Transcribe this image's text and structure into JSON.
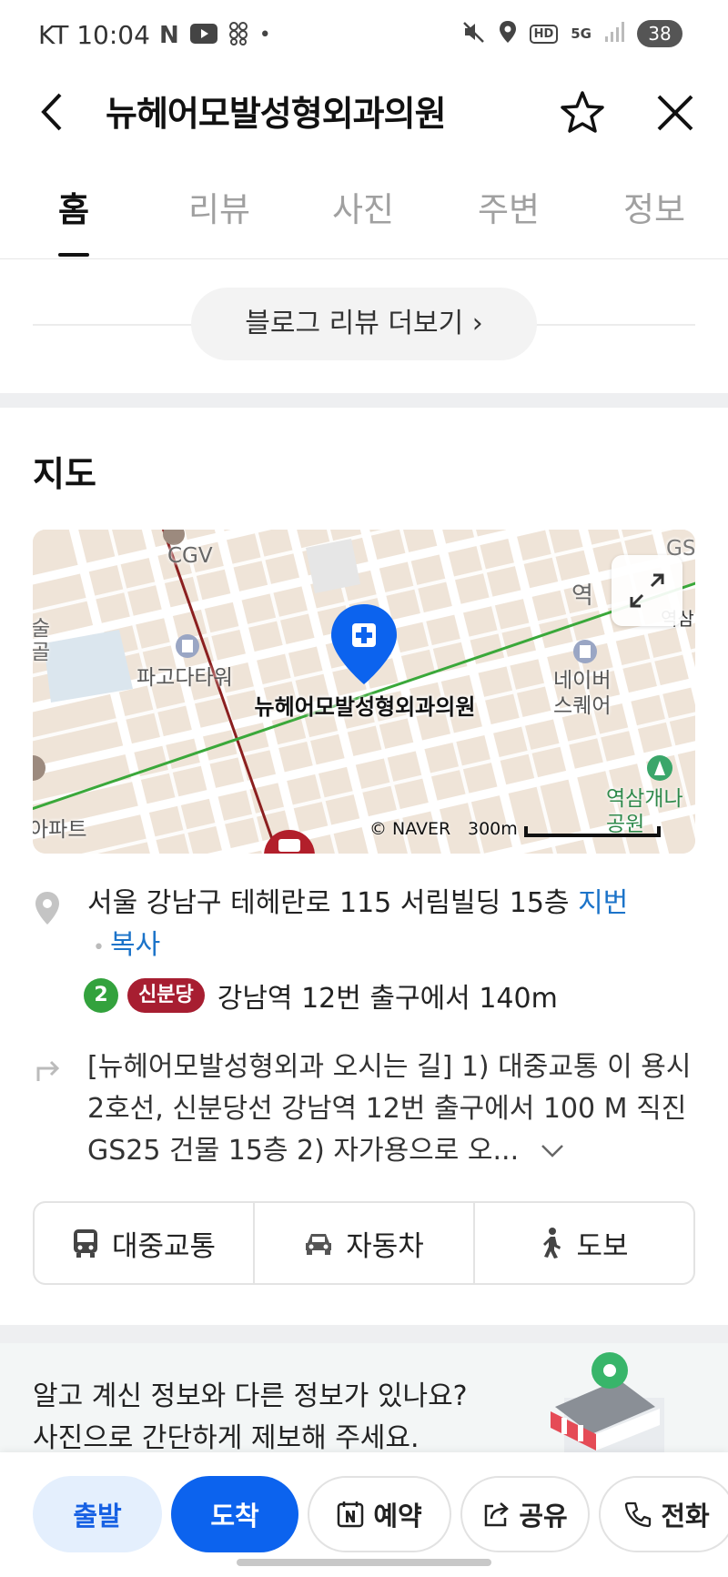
{
  "status_bar": {
    "time": "KT 10:04",
    "battery": "38",
    "hd_label": "HD",
    "net_label": "5G"
  },
  "header": {
    "title": "뉴헤어모발성형외과의원"
  },
  "tabs": [
    {
      "label": "홈",
      "active": true
    },
    {
      "label": "리뷰",
      "active": false
    },
    {
      "label": "사진",
      "active": false
    },
    {
      "label": "주변",
      "active": false
    },
    {
      "label": "정보",
      "active": false
    }
  ],
  "blog": {
    "more_label": "블로그 리뷰 더보기 ›"
  },
  "map": {
    "heading": "지도",
    "place_name": "뉴헤어모발성형외과의원",
    "labels": {
      "cgv": "CGV",
      "gs": "GS",
      "pagoda": "파고다타워",
      "naver_square": "네이버\n스퀘어",
      "yeoksam_park": "역삼개나\n공원",
      "apart": "아파트",
      "yeok": "역",
      "yeoksam_station": "역삼역",
      "left_edge": "술\n골"
    },
    "credit": "© NAVER",
    "scale": "300m"
  },
  "address": {
    "text": "서울 강남구 테헤란로 115 서림빌딩 15층",
    "jibun_link": "지번",
    "copy_link": "복사"
  },
  "subway": {
    "line2": "2",
    "line_sinbundang": "신분당",
    "text": "강남역 12번 출구에서 140m"
  },
  "directions": {
    "text": "[뉴헤어모발성형외과 오시는 길] 1) 대중교통 이 용시 2호선, 신분당선 강남역 12번 출구에서 100 M 직진 GS25 건물 15층 2) 자가용으로 오..."
  },
  "routes": [
    {
      "label": "대중교통",
      "icon": "bus-icon"
    },
    {
      "label": "자동차",
      "icon": "car-icon"
    },
    {
      "label": "도보",
      "icon": "walk-icon"
    }
  ],
  "banner": {
    "line1": "알고 계신 정보와 다른 정보가 있나요?",
    "line2": "사진으로 간단하게 제보해 주세요."
  },
  "bottom_bar": {
    "depart": "출발",
    "arrive": "도착",
    "reserve": "예약",
    "share": "공유",
    "call": "전화"
  },
  "colors": {
    "accent_blue": "#0c63ee",
    "line2_green": "#33a23d",
    "sinbundang_red": "#a71e31",
    "link_blue": "#1b73c9"
  }
}
